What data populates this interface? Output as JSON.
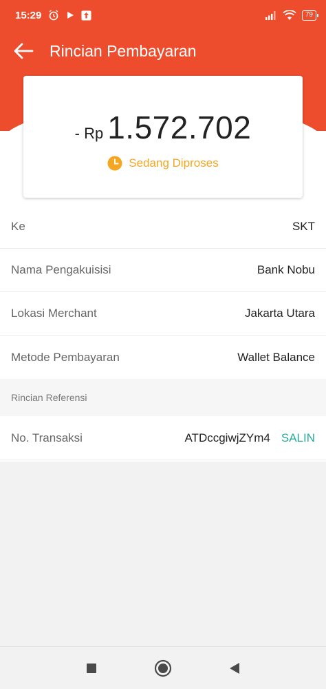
{
  "status_bar": {
    "time": "15:29",
    "battery": "79",
    "icons": [
      "alarm-icon",
      "play-icon",
      "upload-icon",
      "signal-icon",
      "wifi-icon",
      "battery-icon"
    ]
  },
  "header": {
    "title": "Rincian Pembayaran",
    "back_icon": "arrow-left-icon",
    "color": "#ee4d2d"
  },
  "amount": {
    "prefix": "- Rp",
    "value": "1.572.702",
    "status": "Sedang Diproses",
    "status_color": "#f5a623"
  },
  "details": [
    {
      "label": "Ke",
      "value": "SKT"
    },
    {
      "label": "Nama Pengakuisisi",
      "value": "Bank Nobu"
    },
    {
      "label": "Lokasi Merchant",
      "value": "Jakarta Utara"
    },
    {
      "label": "Metode Pembayaran",
      "value": "Wallet Balance"
    }
  ],
  "reference": {
    "section_title": "Rincian Referensi",
    "label": "No. Transaksi",
    "value": "ATDccgiwjZYm4",
    "copy_label": "SALIN",
    "copy_color": "#26aa99"
  },
  "nav": {
    "icons": [
      "recents-square-icon",
      "home-circle-icon",
      "back-triangle-icon"
    ]
  }
}
